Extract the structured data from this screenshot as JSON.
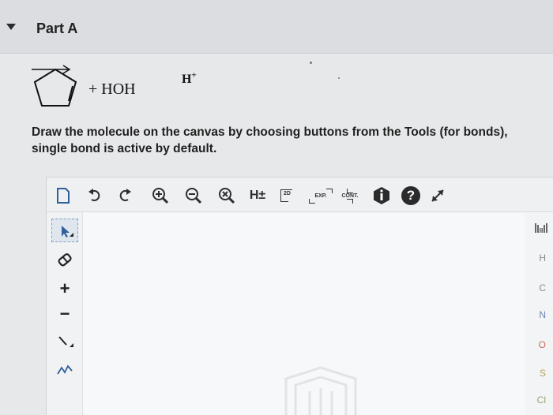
{
  "header": {
    "part_title": "Part A",
    "caret_icon": "caret-down-icon"
  },
  "reaction": {
    "reactant_structure": "cyclopentene",
    "plus_reagent": "+ HOH",
    "catalyst": "H+"
  },
  "instructions": {
    "line1": "Draw the molecule on the canvas by choosing buttons from the Tools (for bonds),",
    "line2": "single bond is active by default."
  },
  "toolbar": {
    "items": [
      {
        "name": "new-document-icon"
      },
      {
        "name": "undo-icon"
      },
      {
        "name": "redo-icon"
      },
      {
        "name": "zoom-in-icon"
      },
      {
        "name": "zoom-out-icon"
      },
      {
        "name": "clear-icon"
      },
      {
        "name": "hydrogen-toggle",
        "label": "H±"
      },
      {
        "name": "2d-clean-button",
        "label": "2D"
      },
      {
        "name": "expand-button",
        "label": "EXP."
      },
      {
        "name": "contract-button",
        "label": "CONT."
      },
      {
        "name": "info-icon"
      },
      {
        "name": "help-icon",
        "label": "?"
      },
      {
        "name": "fullscreen-icon"
      }
    ]
  },
  "left_tools": {
    "items": [
      {
        "name": "select-tool-icon"
      },
      {
        "name": "eraser-icon"
      },
      {
        "name": "charge-plus-icon",
        "label": "+"
      },
      {
        "name": "charge-minus-icon",
        "label": "−"
      },
      {
        "name": "single-bond-icon"
      },
      {
        "name": "chain-tool-icon"
      }
    ]
  },
  "right_tools": {
    "periodic_table_icon": "periodic-table-icon",
    "elements": [
      "H",
      "C",
      "N",
      "O",
      "S",
      "Cl"
    ]
  },
  "colors": {
    "header_bg": "#dcdde1",
    "page_bg": "#e7e8ea",
    "help_dark": "#2b2b2b",
    "oxygen": "#c96a5a",
    "sulfur": "#b7a25a",
    "nitrogen": "#6b86b3"
  }
}
